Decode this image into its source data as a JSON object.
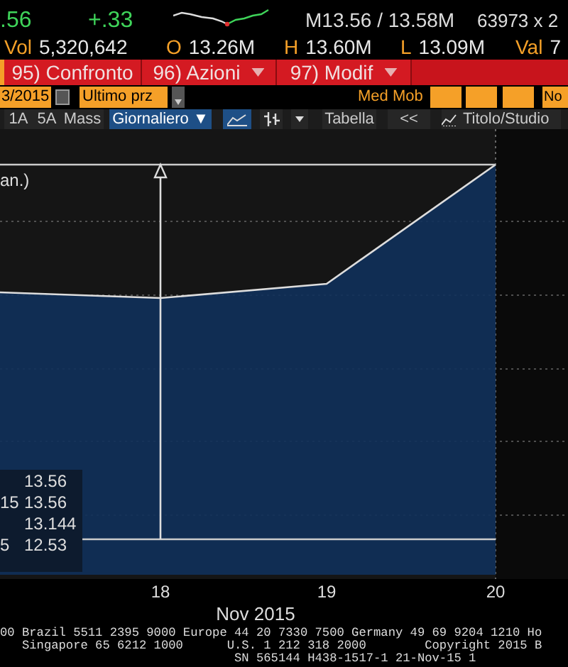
{
  "quote": {
    "last": ".56",
    "change": "+.33",
    "bid_ask": "M13.56 / 13.58M",
    "size": "63973 x 2"
  },
  "stats": [
    {
      "label": "Vol",
      "value": "5,320,642"
    },
    {
      "label": "O",
      "value": "13.26M"
    },
    {
      "label": "H",
      "value": "13.60M"
    },
    {
      "label": "L",
      "value": "13.09M"
    },
    {
      "label": "Val",
      "value": "7"
    }
  ],
  "action_bar": [
    {
      "label": "95) Confronto",
      "dropdown": false
    },
    {
      "label": "96) Azioni",
      "dropdown": true
    },
    {
      "label": "97) Modif",
      "dropdown": true
    }
  ],
  "options_bar": {
    "date": "3/2015",
    "field": "Ultimo prz",
    "moving_avg_label": "Med Mob",
    "last_field": "No"
  },
  "toolbar": [
    {
      "kind": "text",
      "label": "1A",
      "selected": false
    },
    {
      "kind": "text",
      "label": "5A",
      "selected": false
    },
    {
      "kind": "text",
      "label": "Mass",
      "selected": false
    },
    {
      "kind": "dropdown",
      "label": "Giornaliero ▼",
      "selected": true
    },
    {
      "kind": "line-icon",
      "selected": true
    },
    {
      "kind": "bars-icon",
      "selected": false
    },
    {
      "kind": "caret",
      "selected": false
    },
    {
      "kind": "text",
      "label": "Tabella",
      "selected": false
    },
    {
      "kind": "text",
      "label": "<<",
      "selected": false
    },
    {
      "kind": "study",
      "label": "Titolo/Studio",
      "selected": false
    }
  ],
  "chart": {
    "title_fragment": "an.)",
    "legend": [
      {
        "value": "13.56"
      },
      {
        "label": "15",
        "value": "13.56"
      },
      {
        "value": "13.144"
      },
      {
        "label": "5",
        "value": "12.53"
      }
    ],
    "x_ticks": [
      "18",
      "19",
      "20"
    ],
    "x_title": "Nov 2015"
  },
  "footer": [
    "00 Brazil 5511 2395 9000 Europe 44 20 7330 7500 Germany 49 69 9204 1210 Ho",
    "   Singapore 65 6212 1000      U.S. 1 212 318 2000        Copyright 2015 B",
    "                                SN 565144 H438-1517-1 21-Nov-15 1"
  ]
}
